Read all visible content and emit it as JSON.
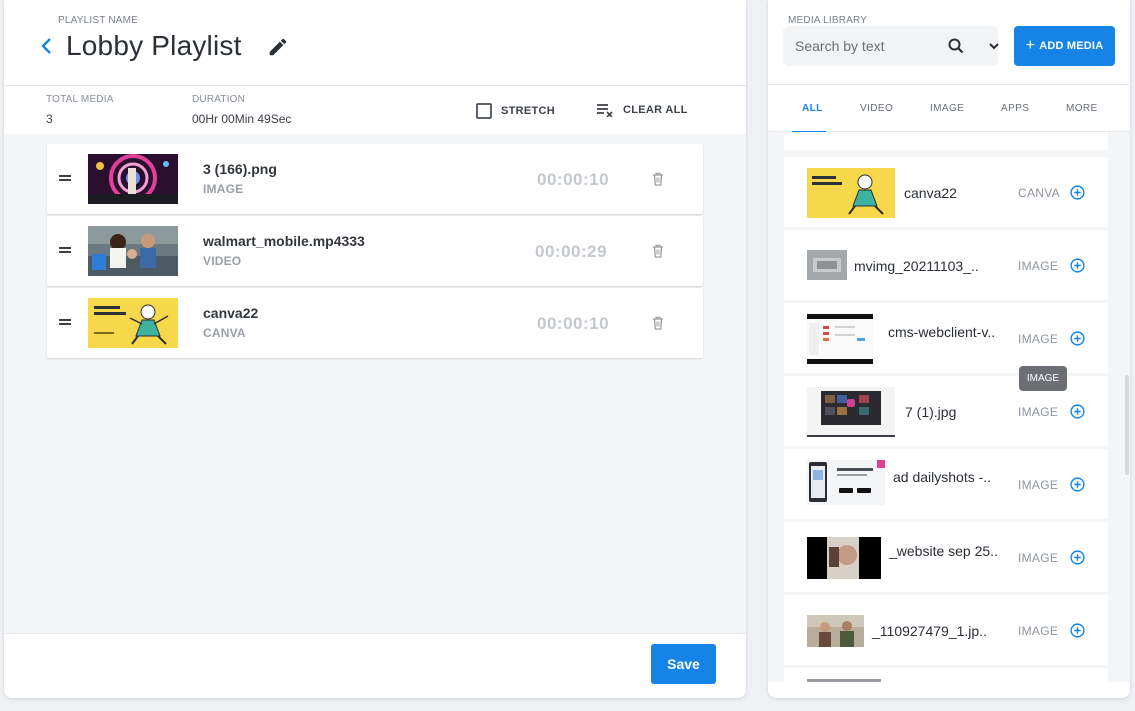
{
  "playlist": {
    "name_label": "PLAYLIST NAME",
    "title": "Lobby Playlist",
    "total_media_label": "TOTAL MEDIA",
    "total_media_value": "3",
    "duration_label": "DURATION",
    "duration_value": "00Hr 00Min 49Sec",
    "stretch_label": "STRETCH",
    "clear_all_label": "CLEAR ALL",
    "items": [
      {
        "name": "3 (166).png",
        "type": "IMAGE",
        "duration": "00:00:10"
      },
      {
        "name": "walmart_mobile.mp4333",
        "type": "VIDEO",
        "duration": "00:00:29"
      },
      {
        "name": "canva22",
        "type": "CANVA",
        "duration": "00:00:10"
      }
    ],
    "save_label": "Save"
  },
  "library": {
    "label": "MEDIA LIBRARY",
    "search_placeholder": "Search by text",
    "add_media_label": "ADD MEDIA",
    "tabs": [
      "ALL",
      "VIDEO",
      "IMAGE",
      "APPS",
      "MORE"
    ],
    "active_tab": "ALL",
    "items": [
      {
        "name": "canva22",
        "type": "CANVA"
      },
      {
        "name": "mvimg_20211103_..",
        "type": "IMAGE"
      },
      {
        "name": "cms-webclient-v..",
        "type": "IMAGE"
      },
      {
        "name": "7 (1).jpg",
        "type": "IMAGE"
      },
      {
        "name": "ad dailyshots -..",
        "type": "IMAGE"
      },
      {
        "name": "_website sep 25..",
        "type": "IMAGE"
      },
      {
        "name": "_110927479_1.jp..",
        "type": "IMAGE"
      }
    ],
    "tooltip": "IMAGE"
  },
  "colors": {
    "accent": "#1584e6",
    "canva_thumb": "#f7d84a"
  }
}
